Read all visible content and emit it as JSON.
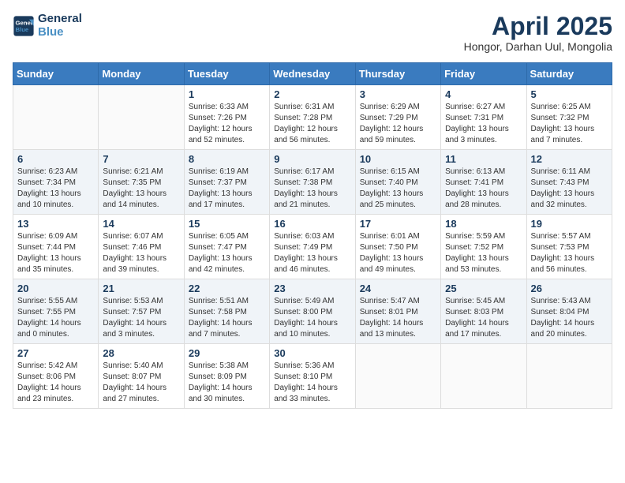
{
  "logo": {
    "line1": "General",
    "line2": "Blue"
  },
  "title": {
    "month_year": "April 2025",
    "location": "Hongor, Darhan Uul, Mongolia"
  },
  "weekdays": [
    "Sunday",
    "Monday",
    "Tuesday",
    "Wednesday",
    "Thursday",
    "Friday",
    "Saturday"
  ],
  "weeks": [
    [
      {
        "day": "",
        "info": ""
      },
      {
        "day": "",
        "info": ""
      },
      {
        "day": "1",
        "info": "Sunrise: 6:33 AM\nSunset: 7:26 PM\nDaylight: 12 hours\nand 52 minutes."
      },
      {
        "day": "2",
        "info": "Sunrise: 6:31 AM\nSunset: 7:28 PM\nDaylight: 12 hours\nand 56 minutes."
      },
      {
        "day": "3",
        "info": "Sunrise: 6:29 AM\nSunset: 7:29 PM\nDaylight: 12 hours\nand 59 minutes."
      },
      {
        "day": "4",
        "info": "Sunrise: 6:27 AM\nSunset: 7:31 PM\nDaylight: 13 hours\nand 3 minutes."
      },
      {
        "day": "5",
        "info": "Sunrise: 6:25 AM\nSunset: 7:32 PM\nDaylight: 13 hours\nand 7 minutes."
      }
    ],
    [
      {
        "day": "6",
        "info": "Sunrise: 6:23 AM\nSunset: 7:34 PM\nDaylight: 13 hours\nand 10 minutes."
      },
      {
        "day": "7",
        "info": "Sunrise: 6:21 AM\nSunset: 7:35 PM\nDaylight: 13 hours\nand 14 minutes."
      },
      {
        "day": "8",
        "info": "Sunrise: 6:19 AM\nSunset: 7:37 PM\nDaylight: 13 hours\nand 17 minutes."
      },
      {
        "day": "9",
        "info": "Sunrise: 6:17 AM\nSunset: 7:38 PM\nDaylight: 13 hours\nand 21 minutes."
      },
      {
        "day": "10",
        "info": "Sunrise: 6:15 AM\nSunset: 7:40 PM\nDaylight: 13 hours\nand 25 minutes."
      },
      {
        "day": "11",
        "info": "Sunrise: 6:13 AM\nSunset: 7:41 PM\nDaylight: 13 hours\nand 28 minutes."
      },
      {
        "day": "12",
        "info": "Sunrise: 6:11 AM\nSunset: 7:43 PM\nDaylight: 13 hours\nand 32 minutes."
      }
    ],
    [
      {
        "day": "13",
        "info": "Sunrise: 6:09 AM\nSunset: 7:44 PM\nDaylight: 13 hours\nand 35 minutes."
      },
      {
        "day": "14",
        "info": "Sunrise: 6:07 AM\nSunset: 7:46 PM\nDaylight: 13 hours\nand 39 minutes."
      },
      {
        "day": "15",
        "info": "Sunrise: 6:05 AM\nSunset: 7:47 PM\nDaylight: 13 hours\nand 42 minutes."
      },
      {
        "day": "16",
        "info": "Sunrise: 6:03 AM\nSunset: 7:49 PM\nDaylight: 13 hours\nand 46 minutes."
      },
      {
        "day": "17",
        "info": "Sunrise: 6:01 AM\nSunset: 7:50 PM\nDaylight: 13 hours\nand 49 minutes."
      },
      {
        "day": "18",
        "info": "Sunrise: 5:59 AM\nSunset: 7:52 PM\nDaylight: 13 hours\nand 53 minutes."
      },
      {
        "day": "19",
        "info": "Sunrise: 5:57 AM\nSunset: 7:53 PM\nDaylight: 13 hours\nand 56 minutes."
      }
    ],
    [
      {
        "day": "20",
        "info": "Sunrise: 5:55 AM\nSunset: 7:55 PM\nDaylight: 14 hours\nand 0 minutes."
      },
      {
        "day": "21",
        "info": "Sunrise: 5:53 AM\nSunset: 7:57 PM\nDaylight: 14 hours\nand 3 minutes."
      },
      {
        "day": "22",
        "info": "Sunrise: 5:51 AM\nSunset: 7:58 PM\nDaylight: 14 hours\nand 7 minutes."
      },
      {
        "day": "23",
        "info": "Sunrise: 5:49 AM\nSunset: 8:00 PM\nDaylight: 14 hours\nand 10 minutes."
      },
      {
        "day": "24",
        "info": "Sunrise: 5:47 AM\nSunset: 8:01 PM\nDaylight: 14 hours\nand 13 minutes."
      },
      {
        "day": "25",
        "info": "Sunrise: 5:45 AM\nSunset: 8:03 PM\nDaylight: 14 hours\nand 17 minutes."
      },
      {
        "day": "26",
        "info": "Sunrise: 5:43 AM\nSunset: 8:04 PM\nDaylight: 14 hours\nand 20 minutes."
      }
    ],
    [
      {
        "day": "27",
        "info": "Sunrise: 5:42 AM\nSunset: 8:06 PM\nDaylight: 14 hours\nand 23 minutes."
      },
      {
        "day": "28",
        "info": "Sunrise: 5:40 AM\nSunset: 8:07 PM\nDaylight: 14 hours\nand 27 minutes."
      },
      {
        "day": "29",
        "info": "Sunrise: 5:38 AM\nSunset: 8:09 PM\nDaylight: 14 hours\nand 30 minutes."
      },
      {
        "day": "30",
        "info": "Sunrise: 5:36 AM\nSunset: 8:10 PM\nDaylight: 14 hours\nand 33 minutes."
      },
      {
        "day": "",
        "info": ""
      },
      {
        "day": "",
        "info": ""
      },
      {
        "day": "",
        "info": ""
      }
    ]
  ]
}
